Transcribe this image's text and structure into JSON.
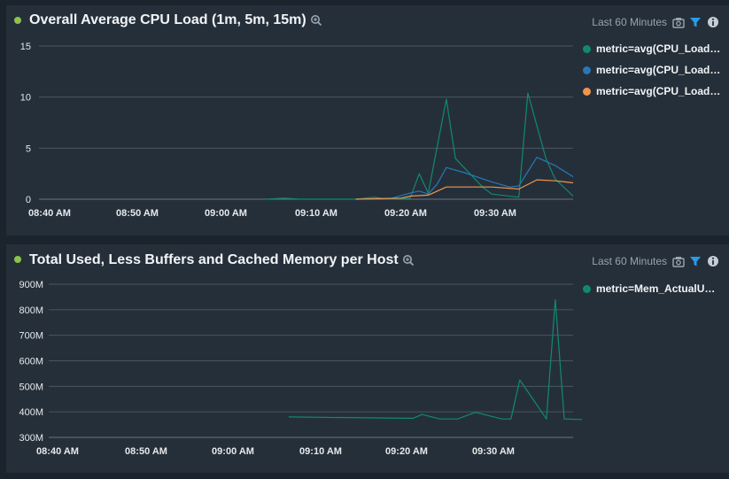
{
  "colors": {
    "green": "#0f8a72",
    "blue": "#2878b8",
    "orange": "#f0964a",
    "status_dot": "#8bc34a",
    "filter": "#2c9be6"
  },
  "panels": [
    {
      "title": "Overall Average CPU Load (1m, 5m, 15m)",
      "range": "Last 60 Minutes",
      "legend": [
        "metric=avg(CPU_Load…",
        "metric=avg(CPU_Load…",
        "metric=avg(CPU_Load…"
      ],
      "icons": [
        "zoom-icon",
        "camera-icon",
        "filter-icon",
        "info-icon"
      ]
    },
    {
      "title": "Total Used, Less Buffers and Cached Memory per Host",
      "range": "Last 60 Minutes",
      "legend": [
        "metric=Mem_ActualU…"
      ],
      "icons": [
        "zoom-icon",
        "camera-icon",
        "filter-icon",
        "info-icon"
      ]
    }
  ],
  "chart_data": [
    {
      "type": "line",
      "title": "Overall Average CPU Load (1m, 5m, 15m)",
      "x_ticks": [
        "08:40 AM",
        "08:50 AM",
        "09:00 AM",
        "09:10 AM",
        "09:20 AM",
        "09:30 AM"
      ],
      "y_ticks": [
        "0",
        "5",
        "10",
        "15"
      ],
      "ylim": [
        0,
        15
      ],
      "xlim_minutes": [
        0,
        59
      ],
      "grid": true,
      "legend_position": "right",
      "series": [
        {
          "color": "#0f8a72",
          "x": [
            25,
            27,
            29,
            35,
            37,
            38.5,
            41,
            42,
            43,
            45,
            46,
            49,
            50,
            53,
            54,
            56,
            57,
            59
          ],
          "y": [
            0,
            0.1,
            0,
            0,
            0.2,
            0,
            0.1,
            2.5,
            0.6,
            9.8,
            4,
            1.2,
            0.5,
            0.2,
            10.4,
            4,
            2,
            0.3
          ]
        },
        {
          "color": "#2878b8",
          "x": [
            35,
            39,
            41,
            42,
            43,
            44,
            45,
            47,
            50,
            52,
            53,
            55,
            57,
            59
          ],
          "y": [
            0,
            0.1,
            0.6,
            0.8,
            0.5,
            1.5,
            3.1,
            2.6,
            1.7,
            1.2,
            1.3,
            4.1,
            3.3,
            2.2
          ]
        },
        {
          "color": "#f0964a",
          "x": [
            35,
            40,
            41,
            43,
            45,
            50,
            53,
            55,
            57,
            59
          ],
          "y": [
            0,
            0.1,
            0.3,
            0.4,
            1.2,
            1.2,
            1.0,
            1.9,
            1.8,
            1.6
          ]
        }
      ]
    },
    {
      "type": "line",
      "title": "Total Used, Less Buffers and Cached Memory per Host",
      "x_ticks": [
        "08:40 AM",
        "08:50 AM",
        "09:00 AM",
        "09:10 AM",
        "09:20 AM",
        "09:30 AM"
      ],
      "y_ticks": [
        "300M",
        "400M",
        "500M",
        "600M",
        "700M",
        "800M",
        "900M"
      ],
      "ylim": [
        300,
        900
      ],
      "xlim_minutes": [
        0,
        59
      ],
      "grid": true,
      "legend_position": "right",
      "series": [
        {
          "color": "#0f8a72",
          "x": [
            27,
            40,
            41,
            42,
            44,
            45,
            46,
            48,
            51,
            52,
            53,
            56,
            57,
            58,
            60
          ],
          "y": [
            380,
            375,
            375,
            390,
            372,
            372,
            372,
            398,
            372,
            372,
            525,
            372,
            840,
            372,
            370
          ]
        }
      ]
    }
  ]
}
